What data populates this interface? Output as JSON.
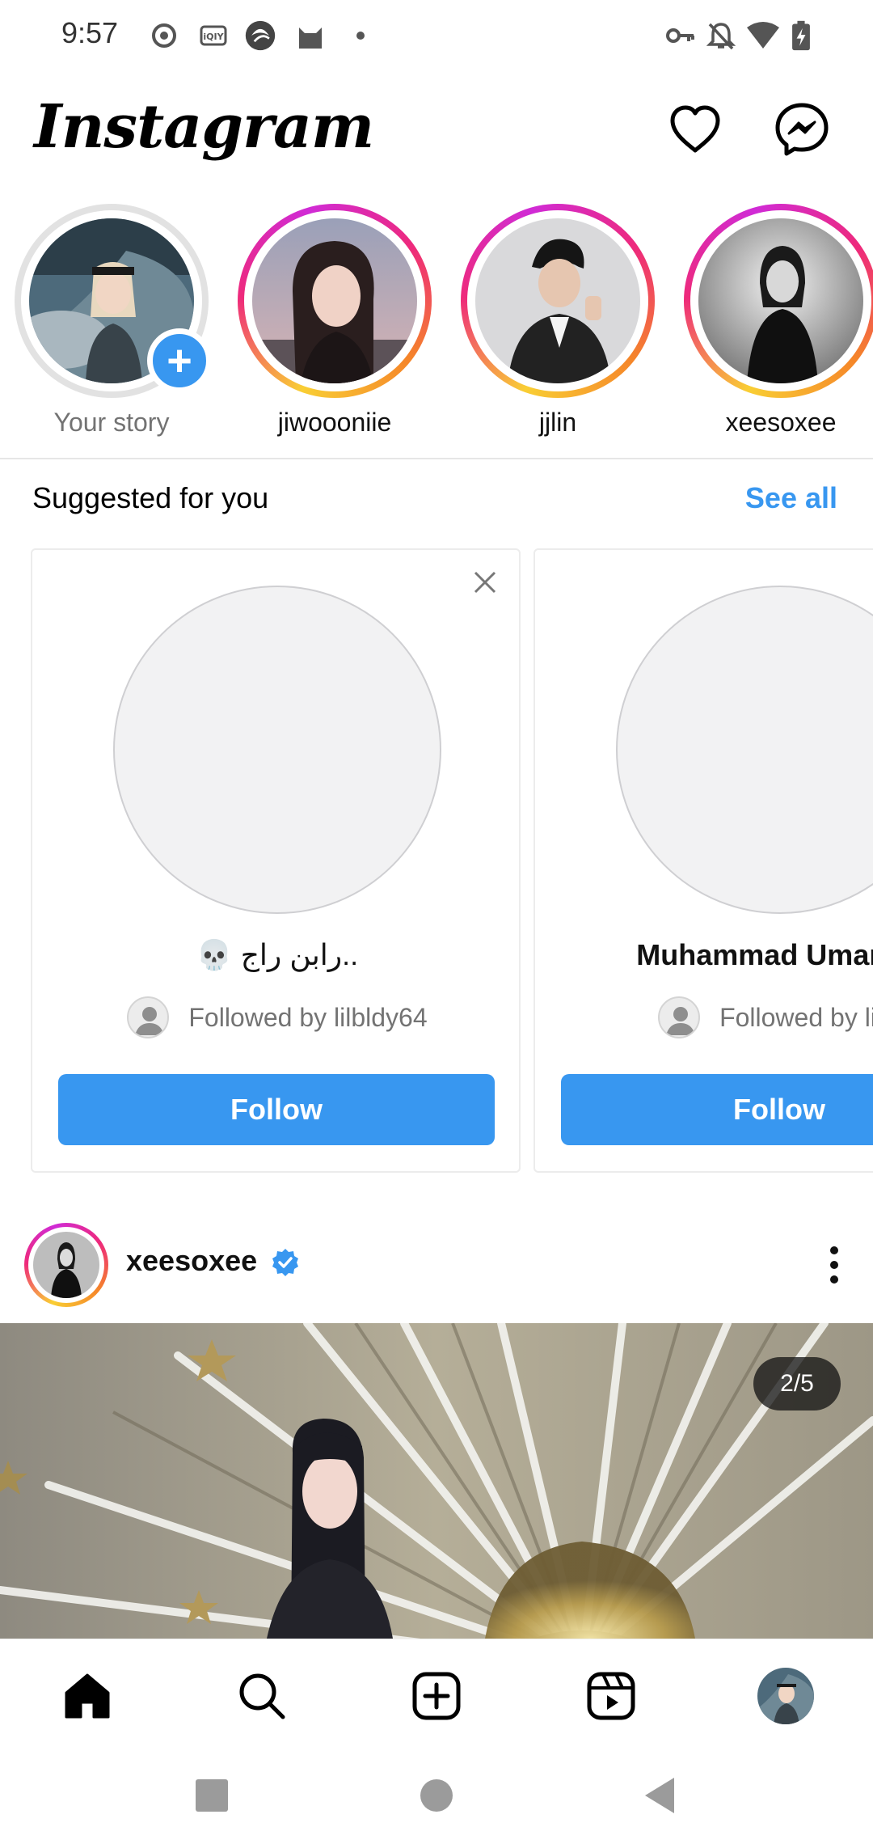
{
  "status_bar": {
    "time": "9:57",
    "left_icons": [
      "record-icon",
      "iqiyi-icon",
      "app-swirl-icon",
      "cat-icon",
      "dot-icon"
    ],
    "right_icons": [
      "vpn-key-icon",
      "bell-off-icon",
      "wifi-icon",
      "battery-charging-icon"
    ]
  },
  "header": {
    "logo": "Instagram",
    "actions": [
      "activity-heart-icon",
      "messenger-icon"
    ]
  },
  "stories": [
    {
      "label": "Your story",
      "is_own": true,
      "add_badge": "+"
    },
    {
      "label": "jiwoooniie"
    },
    {
      "label": "jjlin"
    },
    {
      "label": "xeesoxee"
    }
  ],
  "suggested": {
    "title": "Suggested for you",
    "see_all": "See all",
    "cards": [
      {
        "name": "💀 رابن راج..",
        "followed_by": "Followed by lilbldy64",
        "follow": "Follow"
      },
      {
        "name": "Muhammad Umar Yu",
        "followed_by": "Followed by lilbl",
        "follow": "Follow"
      }
    ]
  },
  "post": {
    "username": "xeesoxee",
    "verified": true,
    "counter": "2/5"
  },
  "bottom_nav": [
    "home-icon",
    "search-icon",
    "create-post-icon",
    "reels-icon",
    "profile-avatar"
  ],
  "android_nav": [
    "recents-square",
    "home-circle",
    "back-triangle"
  ],
  "colors": {
    "accent": "#3897f0",
    "text": "#000000",
    "muted": "#737373"
  }
}
